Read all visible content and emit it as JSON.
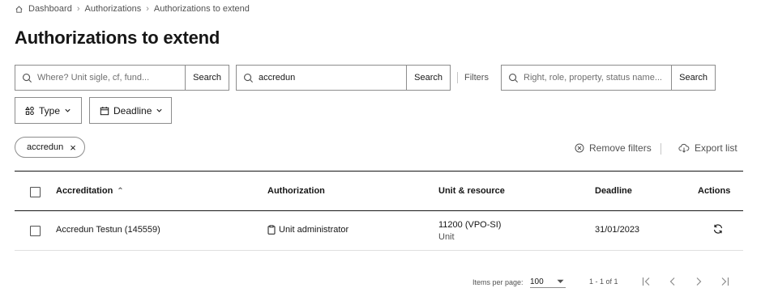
{
  "breadcrumb": {
    "items": [
      "Dashboard",
      "Authorizations",
      "Authorizations to extend"
    ]
  },
  "page": {
    "title": "Authorizations to extend"
  },
  "search": {
    "unit": {
      "placeholder": "Where? Unit sigle, cf, fund...",
      "value": "",
      "button": "Search"
    },
    "person": {
      "placeholder": "",
      "value": "accredun",
      "button": "Search"
    },
    "filters_label": "Filters",
    "right": {
      "placeholder": "Right, role, property, status name...",
      "value": "",
      "button": "Search"
    }
  },
  "dropdowns": {
    "type": "Type",
    "deadline": "Deadline"
  },
  "chips": [
    {
      "label": "accredun"
    }
  ],
  "toolbar": {
    "remove_filters": "Remove filters",
    "export_list": "Export list"
  },
  "table": {
    "columns": {
      "accreditation": "Accreditation",
      "authorization": "Authorization",
      "unit_resource": "Unit & resource",
      "deadline": "Deadline",
      "actions": "Actions"
    },
    "sort": {
      "column": "accreditation",
      "direction": "ascending"
    },
    "rows": [
      {
        "accreditation": "Accredun Testun (145559)",
        "authorization": "Unit administrator",
        "unit": "11200 (VPO-SI)",
        "resource": "Unit",
        "deadline": "31/01/2023"
      }
    ]
  },
  "pagination": {
    "items_per_page_label": "Items per page:",
    "items_per_page": "100",
    "range": "1 - 1 of 1"
  },
  "icons": {
    "breadcrumb": "home-icon",
    "search": "search-icon",
    "type": "shapes-icon",
    "deadline": "calendar-icon",
    "remove": "close-circle-icon",
    "export": "cloud-download-icon",
    "authorization": "clipboard-icon",
    "renew": "refresh-icon"
  }
}
